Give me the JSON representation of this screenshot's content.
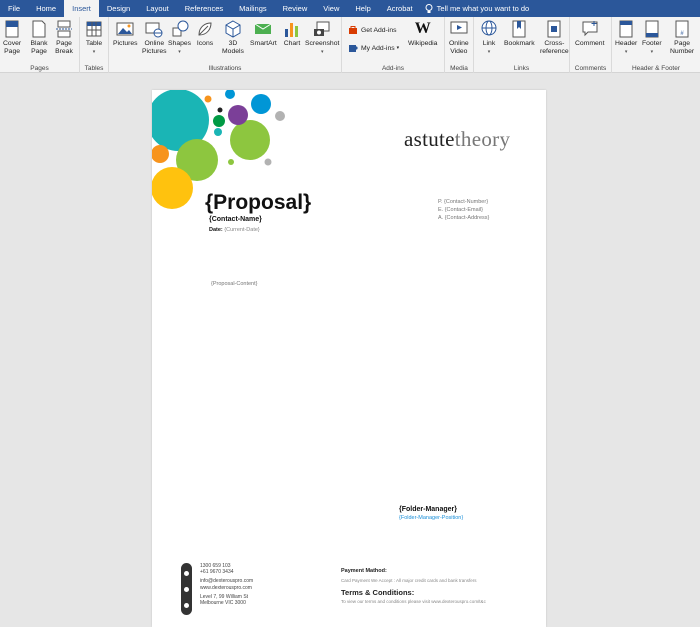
{
  "ribbon": {
    "tabs": [
      "File",
      "Home",
      "Insert",
      "Design",
      "Layout",
      "References",
      "Mailings",
      "Review",
      "View",
      "Help",
      "Acrobat"
    ],
    "active_tab": "Insert",
    "tell_me": "Tell me what you want to do",
    "groups": {
      "pages": "Pages",
      "tables": "Tables",
      "illustrations": "Illustrations",
      "addins": "Add-ins",
      "media": "Media",
      "links": "Links",
      "comments": "Comments",
      "header_footer": "Header & Footer"
    },
    "buttons": {
      "cover_page_1": "Cover",
      "cover_page_2": "Page",
      "blank_page_1": "Blank",
      "blank_page_2": "Page",
      "page_break_1": "Page",
      "page_break_2": "Break",
      "table": "Table",
      "pictures": "Pictures",
      "online_pictures_1": "Online",
      "online_pictures_2": "Pictures",
      "shapes": "Shapes",
      "icons": "Icons",
      "models_1": "3D",
      "models_2": "Models",
      "smartart": "SmartArt",
      "chart": "Chart",
      "screenshot": "Screenshot",
      "get_addins": "Get Add-ins",
      "my_addins": "My Add-ins",
      "wikipedia": "Wikipedia",
      "online_video_1": "Online",
      "online_video_2": "Video",
      "link": "Link",
      "bookmark": "Bookmark",
      "cross_ref_1": "Cross-",
      "cross_ref_2": "reference",
      "comment": "Comment",
      "header": "Header",
      "footer": "Footer",
      "page_number_1": "Page",
      "page_number_2": "Number"
    },
    "colors": {
      "accent": "#2b579a"
    }
  },
  "document": {
    "logo_dark": "astute",
    "logo_light": "theory",
    "title": "{Proposal}",
    "contact_name": "{Contact-Name}",
    "date_label": "Date:",
    "date_value": "{Current-Date}",
    "contact_number": "P. {Contact-Number}",
    "contact_email": "E. {Contact-Email}",
    "contact_address": "A. {Contact-Address}",
    "proposal_content": "{Proposal-Content}",
    "folder_manager": "{Folder-Manager}",
    "folder_manager_position": "{Folder-Manager-Position}",
    "footer": {
      "phone_1": "1300 659 103",
      "phone_2": "+61 9670 3434",
      "email": "info@dexterouspro.com",
      "website": "www.dexterouspro.com",
      "address_1": "Level 7, 99 William St",
      "address_2": "Melbourne VIC 3000",
      "payment_title": "Payment Mathod:",
      "payment_text": "Card Payment We Accept : All major credit cards and bank transfers",
      "terms_title": "Terms & Conditions:",
      "terms_text": "To view our terms and conditions please visit www.dexterouspro.com/t&c"
    },
    "circle_colors": [
      "#1ab5b5",
      "#8dc63f",
      "#f7941d",
      "#ffc20e",
      "#0096d6",
      "#7b3f98",
      "#009a44",
      "#b2b2b2"
    ]
  }
}
